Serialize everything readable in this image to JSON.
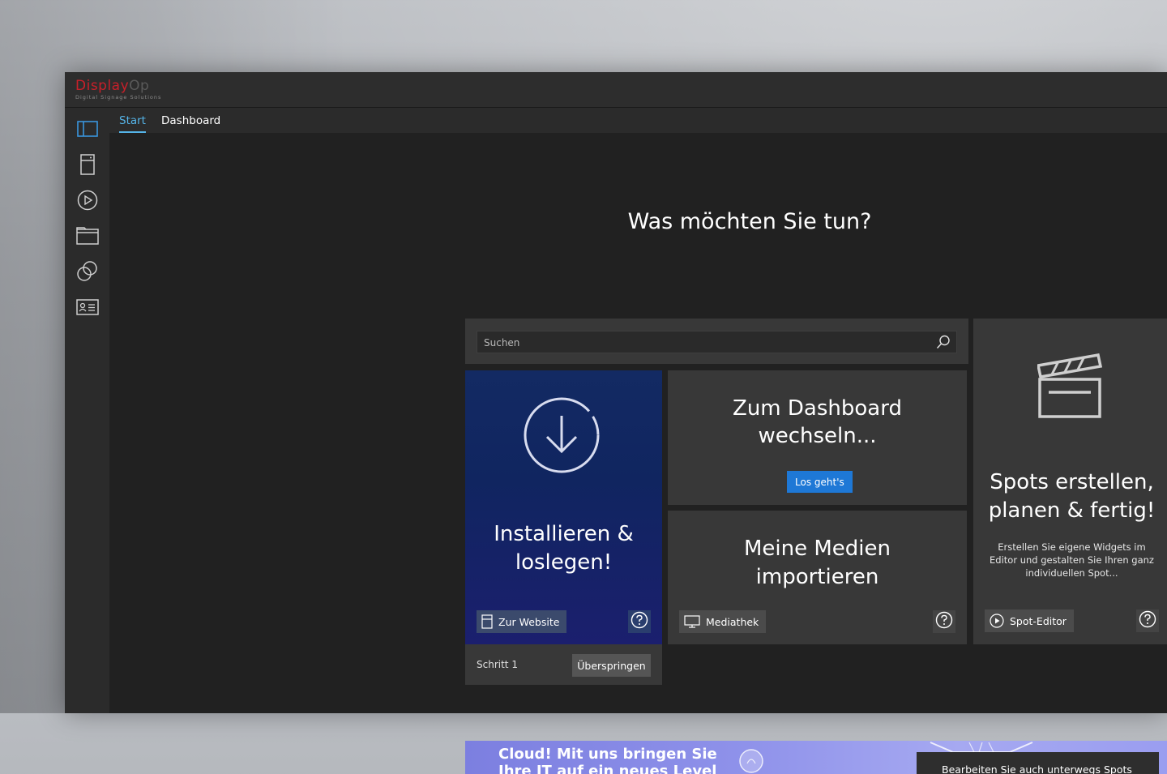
{
  "app": {
    "logo": {
      "brand_part1": "Display",
      "brand_part2": "Op",
      "tagline": "Digital Signage Solutions"
    }
  },
  "sidebar": {
    "items": [
      {
        "icon": "layout-panel-icon",
        "active": true
      },
      {
        "icon": "device-icon",
        "active": false
      },
      {
        "icon": "play-circle-icon",
        "active": false
      },
      {
        "icon": "folder-icon",
        "active": false
      },
      {
        "icon": "overlap-circles-icon",
        "active": false
      },
      {
        "icon": "contact-card-icon",
        "active": false
      }
    ]
  },
  "tabs": [
    {
      "label": "Start",
      "active": true
    },
    {
      "label": "Dashboard",
      "active": false
    }
  ],
  "main": {
    "heading": "Was möchten Sie tun?",
    "search": {
      "placeholder": "Suchen",
      "value": ""
    },
    "install_card": {
      "title_line1": "Installieren &",
      "title_line2": "loslegen!",
      "button_label": "Zur Website",
      "help_icon": "question-circle-icon",
      "download_icon": "download-circle-icon"
    },
    "step": {
      "label": "Schritt 1",
      "skip_label": "Überspringen"
    },
    "dashboard_card": {
      "title_line1": "Zum Dashboard",
      "title_line2": "wechseln...",
      "button_label": "Los geht's"
    },
    "media_card": {
      "title_line1": "Meine Medien",
      "title_line2": "importieren",
      "button_label": "Mediathek"
    },
    "spots_card": {
      "title_line1": "Spots erstellen,",
      "title_line2": "planen & fertig!",
      "description": "Erstellen Sie eigene Widgets im Editor und gestalten Sie Ihren ganz individuellen Spot...",
      "button_label": "Spot-Editor",
      "clapper_icon": "clapperboard-icon"
    },
    "banner": {
      "text_line1": "Cloud! Mit uns bringen Sie",
      "text_line2": "Ihre IT auf ein neues Level",
      "box_text": "Bearbeiten Sie auch unterwegs Spots"
    }
  },
  "colors": {
    "accent": "#3a96dd",
    "primary_button": "#1e78d6",
    "brand_red": "#c8202a",
    "install_card_blue": "#132a63",
    "banner_purple": "#8f92ea"
  }
}
